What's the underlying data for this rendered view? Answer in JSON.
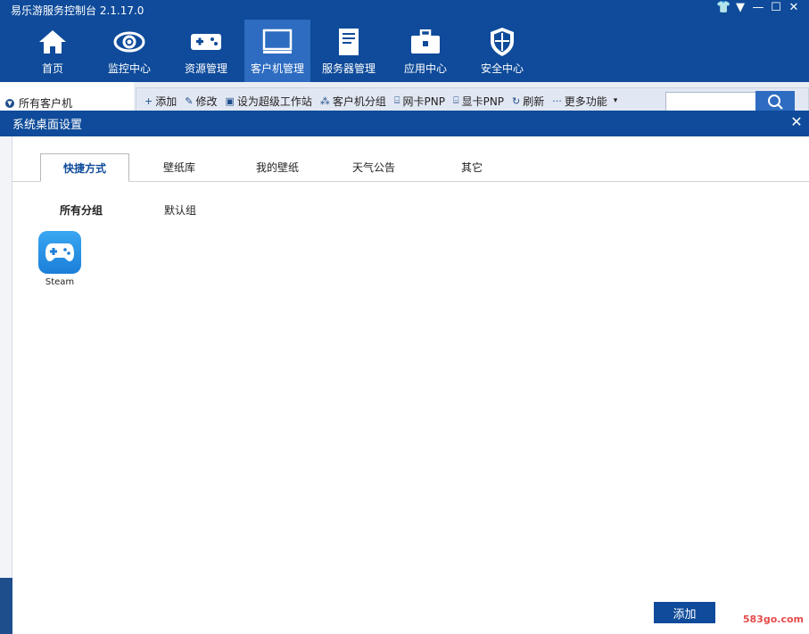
{
  "app": {
    "title": "易乐游服务控制台 2.1.17.0"
  },
  "colors": {
    "primary": "#0f4b9a",
    "active_nav": "#2d6cc0",
    "accent": "#3aa7f2"
  },
  "window_controls": [
    {
      "name": "shirt-icon",
      "glyph": "👕"
    },
    {
      "name": "menu-down-icon",
      "glyph": "▼"
    },
    {
      "name": "minimize-icon",
      "glyph": "—"
    },
    {
      "name": "maximize-icon",
      "glyph": "☐"
    },
    {
      "name": "close-icon",
      "glyph": "✕"
    }
  ],
  "nav": [
    {
      "label": "首页",
      "icon": "home-icon"
    },
    {
      "label": "监控中心",
      "icon": "eye-icon"
    },
    {
      "label": "资源管理",
      "icon": "gamepad-icon"
    },
    {
      "label": "客户机管理",
      "icon": "monitor-icon",
      "active": true
    },
    {
      "label": "服务器管理",
      "icon": "server-icon"
    },
    {
      "label": "应用中心",
      "icon": "toolbox-icon"
    },
    {
      "label": "安全中心",
      "icon": "shield-icon"
    }
  ],
  "sidebar": {
    "root_label": "所有客户机"
  },
  "toolbar": {
    "items": [
      {
        "label": "添加",
        "icon": "plus-icon",
        "glyph": "+"
      },
      {
        "label": "修改",
        "icon": "edit-icon",
        "glyph": "✎"
      },
      {
        "label": "设为超级工作站",
        "icon": "workstation-icon",
        "glyph": "▣"
      },
      {
        "label": "客户机分组",
        "icon": "group-icon",
        "glyph": "⁂"
      },
      {
        "label": "网卡PNP",
        "icon": "nic-icon",
        "glyph": "⌸"
      },
      {
        "label": "显卡PNP",
        "icon": "gpu-icon",
        "glyph": "⌸"
      },
      {
        "label": "刷新",
        "icon": "refresh-icon",
        "glyph": "↻"
      },
      {
        "label": "更多功能",
        "icon": "more-icon",
        "glyph": "···"
      }
    ],
    "more_dropdown_glyph": "▾",
    "search_placeholder": ""
  },
  "dialog": {
    "title": "系统桌面设置",
    "tabs": [
      "快捷方式",
      "壁纸库",
      "我的壁纸",
      "天气公告",
      "其它"
    ],
    "active_tab": 0,
    "groups": [
      "所有分组",
      "默认组"
    ],
    "active_group": 0,
    "shortcuts": [
      {
        "label": "Steam",
        "icon": "gamepad-icon"
      }
    ],
    "add_label": "添加"
  },
  "watermark": "583go.com"
}
